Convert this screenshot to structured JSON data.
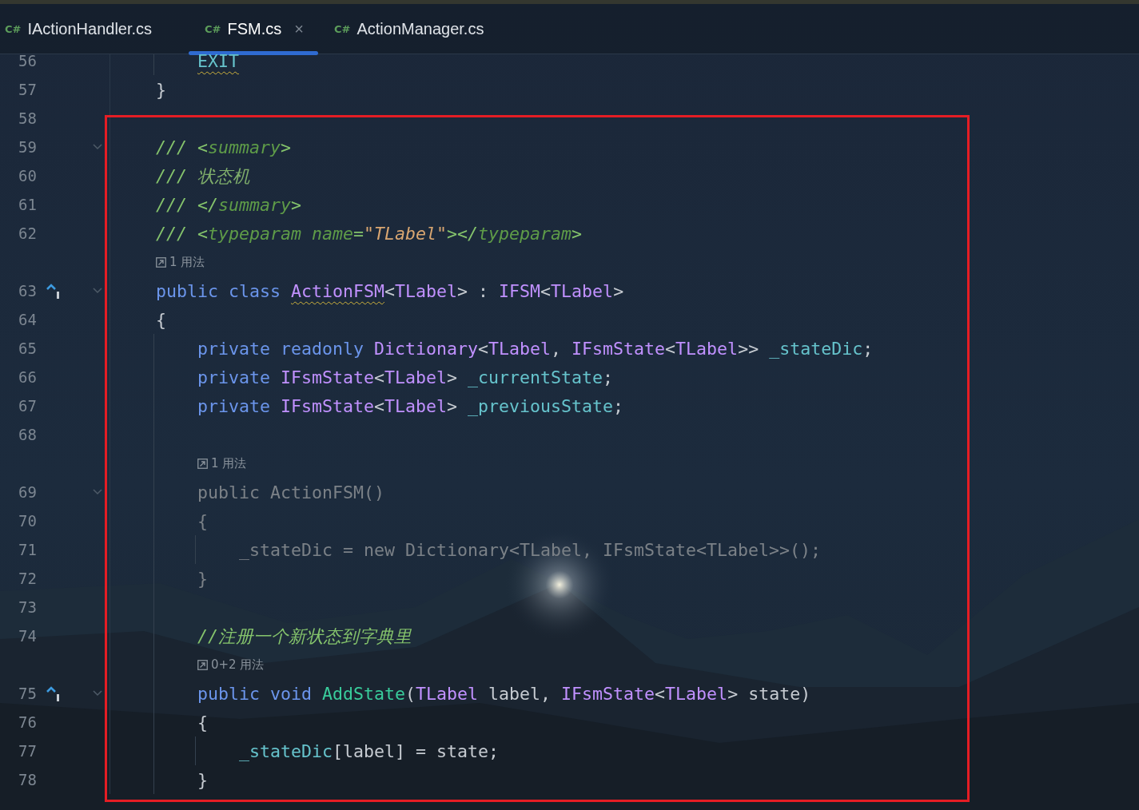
{
  "tabs": [
    {
      "icon": "C#",
      "label": "IActionHandler.cs",
      "selected": false
    },
    {
      "icon": "C#",
      "label": "FSM.cs",
      "selected": true,
      "close": "×"
    },
    {
      "icon": "C#",
      "label": "ActionManager.cs",
      "selected": false
    }
  ],
  "editor": {
    "lines": [
      {
        "kind": "group",
        "children": [
          {
            "kind": "code",
            "number": "56",
            "tokens": [
              {
                "text": "EXIT",
                "kind": "enum",
                "warn": true
              }
            ]
          }
        ]
      },
      {
        "kind": "code",
        "number": "57",
        "tokens": [
          {
            "text": "}",
            "kind": "plain"
          }
        ]
      },
      {
        "kind": "code",
        "number": "58"
      },
      {
        "kind": "code",
        "number": "59",
        "foldable": true,
        "tokens": [
          {
            "text": "/// ",
            "kind": "comment"
          },
          {
            "text": "<",
            "kind": "docpunct"
          },
          {
            "text": "summary",
            "kind": "doctag"
          },
          {
            "text": ">",
            "kind": "docpunct"
          }
        ]
      },
      {
        "kind": "code",
        "number": "60",
        "tokens": [
          {
            "text": "/// ",
            "kind": "comment"
          },
          {
            "text": "状态机",
            "kind": "doctext"
          }
        ]
      },
      {
        "kind": "code",
        "number": "61",
        "tokens": [
          {
            "text": "/// ",
            "kind": "comment"
          },
          {
            "text": "</",
            "kind": "docpunct"
          },
          {
            "text": "summary",
            "kind": "doctag"
          },
          {
            "text": ">",
            "kind": "docpunct"
          }
        ]
      },
      {
        "kind": "code",
        "number": "62",
        "tokens": [
          {
            "text": "/// ",
            "kind": "comment"
          },
          {
            "text": "<",
            "kind": "docpunct"
          },
          {
            "text": "typeparam name",
            "kind": "doctag"
          },
          {
            "text": "=",
            "kind": "docpunct"
          },
          {
            "text": "\"TLabel\"",
            "kind": "docstring"
          },
          {
            "text": "></",
            "kind": "docpunct"
          },
          {
            "text": "typeparam",
            "kind": "doctag"
          },
          {
            "text": ">",
            "kind": "docpunct"
          }
        ]
      },
      {
        "kind": "hint",
        "text": "1 用法"
      },
      {
        "kind": "code",
        "number": "63",
        "implements": true,
        "foldable": true,
        "tokens": [
          {
            "text": "public class ",
            "kind": "keyword"
          },
          {
            "text": "ActionFSM",
            "kind": "type",
            "warn": true
          },
          {
            "text": "<",
            "kind": "plain"
          },
          {
            "text": "TLabel",
            "kind": "type"
          },
          {
            "text": "> : ",
            "kind": "plain"
          },
          {
            "text": "IFSM",
            "kind": "type"
          },
          {
            "text": "<",
            "kind": "plain"
          },
          {
            "text": "TLabel",
            "kind": "type"
          },
          {
            "text": ">",
            "kind": "plain"
          }
        ]
      },
      {
        "kind": "code",
        "number": "64",
        "tokens": [
          {
            "text": "{",
            "kind": "plain"
          }
        ],
        "children": [
          {
            "kind": "code",
            "number": "65",
            "tokens": [
              {
                "text": "private readonly ",
                "kind": "keyword"
              },
              {
                "text": "Dictionary",
                "kind": "type"
              },
              {
                "text": "<",
                "kind": "plain"
              },
              {
                "text": "TLabel",
                "kind": "type"
              },
              {
                "text": ", ",
                "kind": "plain"
              },
              {
                "text": "IFsmState",
                "kind": "type"
              },
              {
                "text": "<",
                "kind": "plain"
              },
              {
                "text": "TLabel",
                "kind": "type"
              },
              {
                "text": ">> ",
                "kind": "plain"
              },
              {
                "text": "_stateDic",
                "kind": "field"
              },
              {
                "text": ";",
                "kind": "plain"
              }
            ]
          },
          {
            "kind": "code",
            "number": "66",
            "tokens": [
              {
                "text": "private ",
                "kind": "keyword"
              },
              {
                "text": "IFsmState",
                "kind": "type"
              },
              {
                "text": "<",
                "kind": "plain"
              },
              {
                "text": "TLabel",
                "kind": "type"
              },
              {
                "text": "> ",
                "kind": "plain"
              },
              {
                "text": "_currentState",
                "kind": "field"
              },
              {
                "text": ";",
                "kind": "plain"
              }
            ]
          },
          {
            "kind": "code",
            "number": "67",
            "tokens": [
              {
                "text": "private ",
                "kind": "keyword"
              },
              {
                "text": "IFsmState",
                "kind": "type"
              },
              {
                "text": "<",
                "kind": "plain"
              },
              {
                "text": "TLabel",
                "kind": "type"
              },
              {
                "text": "> ",
                "kind": "plain"
              },
              {
                "text": "_previousState",
                "kind": "field"
              },
              {
                "text": ";",
                "kind": "plain"
              }
            ]
          },
          {
            "kind": "code",
            "number": "68"
          },
          {
            "kind": "hint",
            "text": "1 用法"
          },
          {
            "kind": "code",
            "number": "69",
            "dimmed": true,
            "foldable": true,
            "tokens": [
              {
                "text": "public ActionFSM()",
                "kind": "plain"
              }
            ]
          },
          {
            "kind": "code",
            "number": "70",
            "dimmed": true,
            "tokens": [
              {
                "text": "{",
                "kind": "plain"
              }
            ],
            "children": [
              {
                "kind": "code",
                "number": "71",
                "dimmed": true,
                "tokens": [
                  {
                    "text": "_stateDic = new Dictionary<TLabel, IFsmState<TLabel>>();",
                    "kind": "plain"
                  }
                ]
              }
            ]
          },
          {
            "kind": "code",
            "number": "72",
            "dimmed": true,
            "tokens": [
              {
                "text": "}",
                "kind": "plain"
              }
            ]
          },
          {
            "kind": "code",
            "number": "73"
          },
          {
            "kind": "code",
            "number": "74",
            "tokens": [
              {
                "text": "//注册一个新状态到字典里",
                "kind": "comment"
              }
            ]
          },
          {
            "kind": "hint",
            "text": "0+2 用法"
          },
          {
            "kind": "code",
            "number": "75",
            "implements": true,
            "foldable": true,
            "tokens": [
              {
                "text": "public void ",
                "kind": "keyword"
              },
              {
                "text": "AddState",
                "kind": "method"
              },
              {
                "text": "(",
                "kind": "plain"
              },
              {
                "text": "TLabel",
                "kind": "type"
              },
              {
                "text": " label, ",
                "kind": "plain"
              },
              {
                "text": "IFsmState",
                "kind": "type"
              },
              {
                "text": "<",
                "kind": "plain"
              },
              {
                "text": "TLabel",
                "kind": "type"
              },
              {
                "text": ">",
                "kind": "plain"
              },
              {
                "text": " state)",
                "kind": "plain"
              }
            ]
          },
          {
            "kind": "code",
            "number": "76",
            "tokens": [
              {
                "text": "{",
                "kind": "plain"
              }
            ],
            "children": [
              {
                "kind": "code",
                "number": "77",
                "tokens": [
                  {
                    "text": "_stateDic",
                    "kind": "field"
                  },
                  {
                    "text": "[label] = state;",
                    "kind": "plain"
                  }
                ]
              }
            ]
          },
          {
            "kind": "code",
            "number": "78",
            "tokens": [
              {
                "text": "}",
                "kind": "plain"
              }
            ]
          }
        ]
      }
    ]
  }
}
